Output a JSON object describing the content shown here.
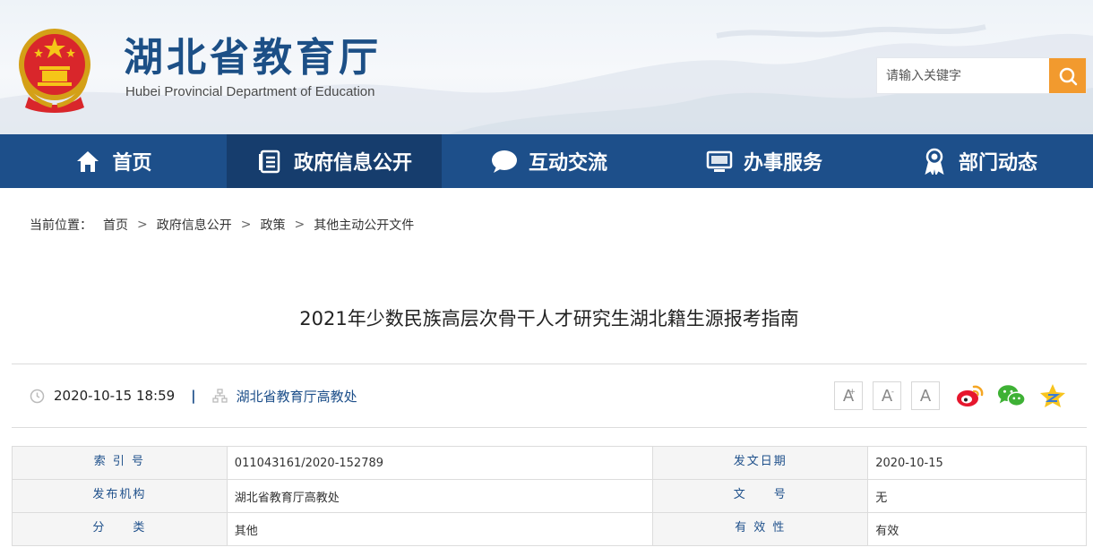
{
  "header": {
    "title": "湖北省教育厅",
    "subtitle": "Hubei Provincial Department of Education",
    "search_placeholder": "请输入关键字"
  },
  "nav": [
    {
      "label": "首页",
      "icon": "home-icon"
    },
    {
      "label": "政府信息公开",
      "icon": "document-list-icon"
    },
    {
      "label": "互动交流",
      "icon": "chat-bubble-icon"
    },
    {
      "label": "办事服务",
      "icon": "monitor-icon"
    },
    {
      "label": "部门动态",
      "icon": "award-badge-icon"
    }
  ],
  "breadcrumb": {
    "prefix": "当前位置：",
    "items": [
      "首页",
      "政府信息公开",
      "政策",
      "其他主动公开文件"
    ],
    "separator": ">"
  },
  "article": {
    "title": "2021年少数民族高层次骨干人才研究生湖北籍生源报考指南",
    "datetime": "2020-10-15 18:59",
    "pipe": "|",
    "publisher": "湖北省教育厅高教处"
  },
  "font_tools": [
    "A",
    "A",
    "A"
  ],
  "font_tools_sup": [
    "+",
    "-"
  ],
  "share": [
    "weibo-icon",
    "wechat-icon",
    "qzone-icon"
  ],
  "info_table": [
    [
      {
        "k": "索 引 号",
        "v": "011043161/2020-152789"
      },
      {
        "k": "发文日期",
        "v": "2020-10-15"
      }
    ],
    [
      {
        "k": "发布机构",
        "v": "湖北省教育厅高教处"
      },
      {
        "k": "文　　号",
        "v": "无"
      }
    ],
    [
      {
        "k": "分　　类",
        "v": "其他"
      },
      {
        "k": "有 效 性",
        "v": "有效"
      }
    ]
  ],
  "colors": {
    "brand_blue": "#1d4f8a",
    "nav_active": "#163d6d",
    "search_orange": "#f29a2e"
  }
}
